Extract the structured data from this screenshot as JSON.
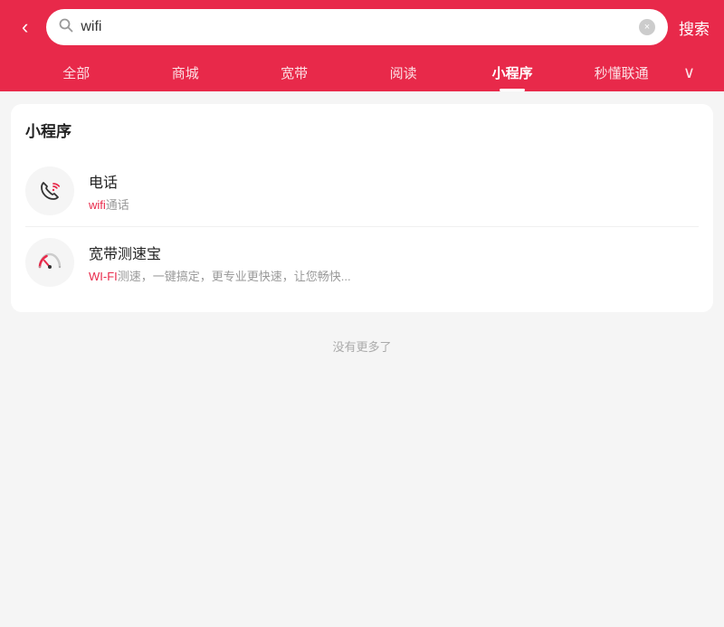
{
  "colors": {
    "primary": "#e8294a",
    "white": "#ffffff",
    "text_dark": "#222222",
    "text_gray": "#999999",
    "text_light": "#aaaaaa"
  },
  "header": {
    "search_value": "wifi",
    "search_placeholder": "搜索",
    "clear_label": "×",
    "submit_label": "搜索",
    "back_icon": "‹"
  },
  "nav": {
    "tabs": [
      {
        "id": "all",
        "label": "全部",
        "active": false
      },
      {
        "id": "mall",
        "label": "商城",
        "active": false
      },
      {
        "id": "broadband",
        "label": "宽带",
        "active": false
      },
      {
        "id": "reading",
        "label": "阅读",
        "active": false
      },
      {
        "id": "miniapp",
        "label": "小程序",
        "active": true
      },
      {
        "id": "smartlink",
        "label": "秒懂联通",
        "active": false
      }
    ],
    "more_icon": "∨"
  },
  "section": {
    "title": "小程序",
    "items": [
      {
        "id": "phone-wifi",
        "title": "电话",
        "subtitle_prefix": "wifi",
        "subtitle_suffix": "通话",
        "icon_type": "phone-wifi"
      },
      {
        "id": "speed-test",
        "title": "宽带测速宝",
        "subtitle_prefix": "WI-FI",
        "subtitle_suffix": "测速，一键搞定，更专业更快速，让您畅快...",
        "icon_type": "speedometer"
      }
    ],
    "no_more_label": "没有更多了"
  }
}
